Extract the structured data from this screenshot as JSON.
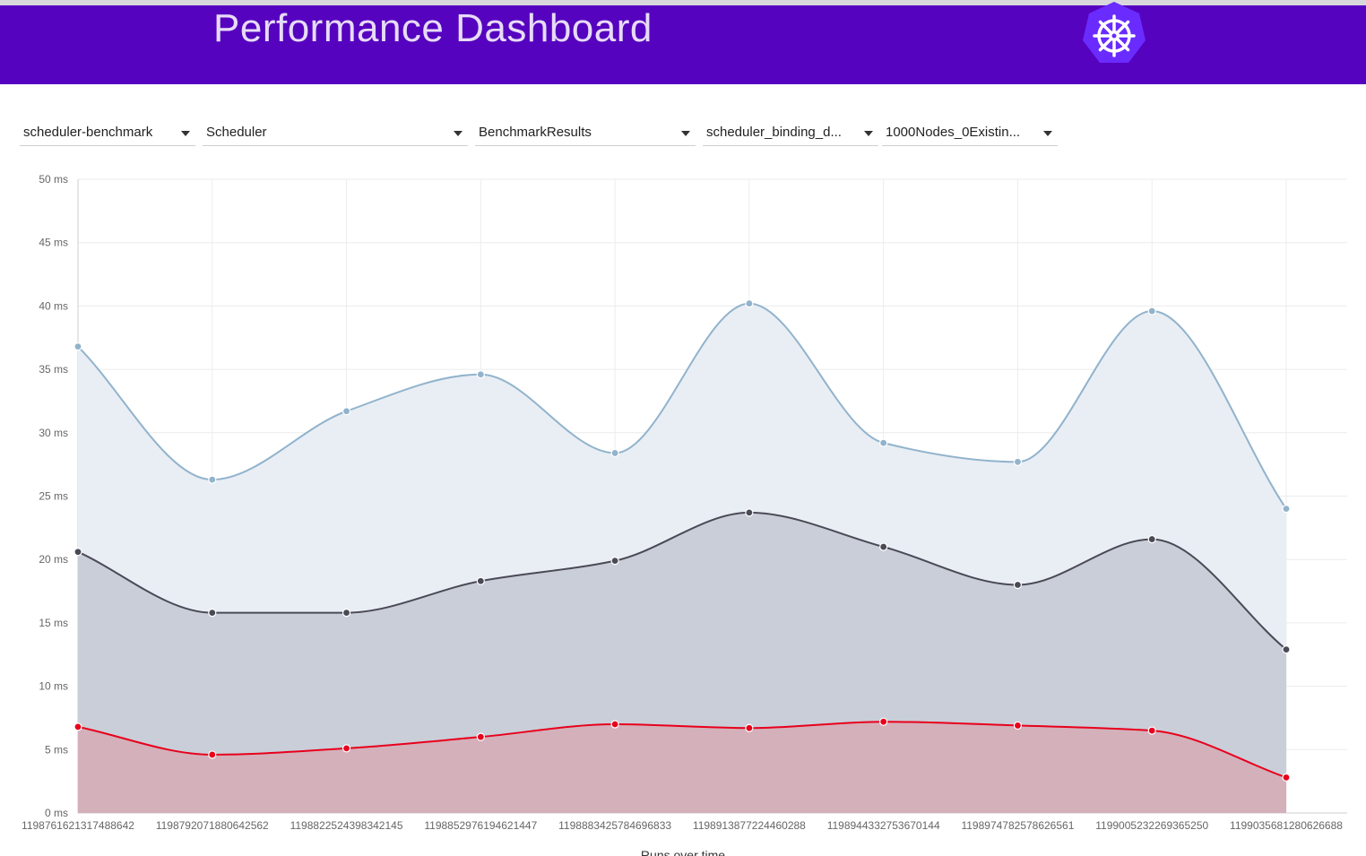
{
  "header": {
    "title": "Performance Dashboard",
    "logo_icon": "kubernetes-helm-icon",
    "color": "#5603bf"
  },
  "filters": [
    {
      "value": "scheduler-benchmark"
    },
    {
      "value": "Scheduler"
    },
    {
      "value": "BenchmarkResults"
    },
    {
      "value": "scheduler_binding_d..."
    },
    {
      "value": "1000Nodes_0Existin..."
    }
  ],
  "chart_data": {
    "type": "area",
    "x": [
      "1198761621317488642",
      "1198792071880642562",
      "1198822524398342145",
      "1198852976194621447",
      "1198883425784696833",
      "1198913877224460288",
      "1198944332753670144",
      "1198974782578626561",
      "1199005232269365250",
      "1199035681280626688"
    ],
    "xlabel": "Runs over time",
    "ylabel": "",
    "ylim": [
      0,
      50
    ],
    "yticks": [
      "0 ms",
      "5 ms",
      "10 ms",
      "15 ms",
      "20 ms",
      "25 ms",
      "30 ms",
      "35 ms",
      "40 ms",
      "45 ms",
      "50 ms"
    ],
    "grid": true,
    "series": [
      {
        "values": [
          36.8,
          26.3,
          31.7,
          34.6,
          28.4,
          40.2,
          29.2,
          27.7,
          39.6,
          24.0
        ],
        "color": "#91b3cc",
        "fill": "#e9eef5"
      },
      {
        "values": [
          20.6,
          15.8,
          15.8,
          18.3,
          19.9,
          23.7,
          21.0,
          18.0,
          21.6,
          12.9
        ],
        "color": "#4a4a56",
        "fill": "#c9ced8"
      },
      {
        "values": [
          6.8,
          4.6,
          5.1,
          6.0,
          7.0,
          6.7,
          7.2,
          6.9,
          6.5,
          2.8
        ],
        "color": "#e8001c",
        "fill": "#d4b0ba"
      }
    ]
  }
}
